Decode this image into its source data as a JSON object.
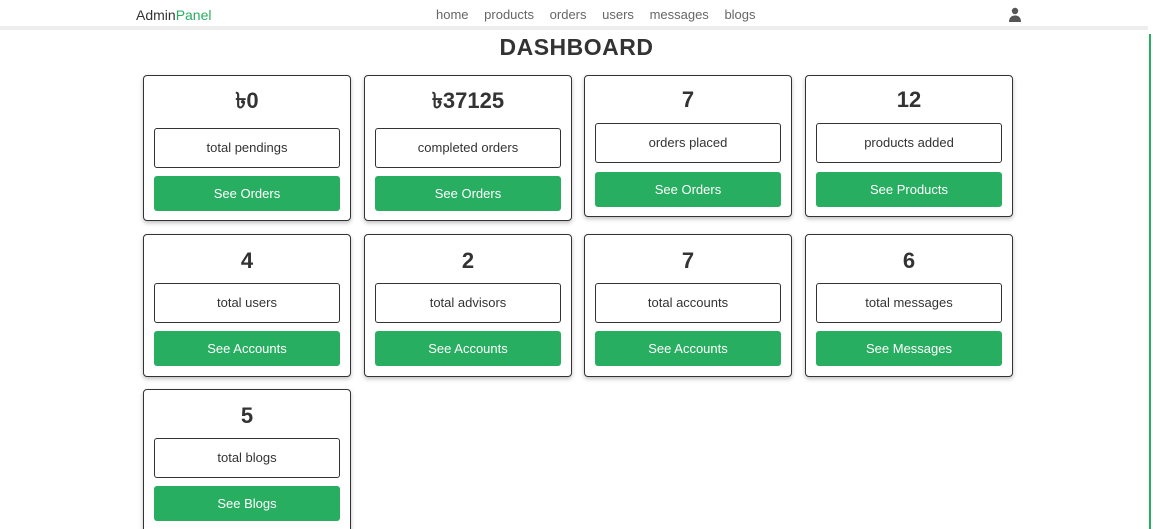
{
  "header": {
    "logo_prefix": "Admin",
    "logo_accent": "Panel",
    "nav": [
      "home",
      "products",
      "orders",
      "users",
      "messages",
      "blogs"
    ],
    "user_icon": "user-icon"
  },
  "title": "DASHBOARD",
  "colors": {
    "accent": "#27ae60",
    "text": "#333333"
  },
  "cards": [
    {
      "value": "৳0",
      "label": "total pendings",
      "button": "See Orders"
    },
    {
      "value": "৳37125",
      "label": "completed orders",
      "button": "See Orders"
    },
    {
      "value": "7",
      "label": "orders placed",
      "button": "See Orders"
    },
    {
      "value": "12",
      "label": "products added",
      "button": "See Products"
    },
    {
      "value": "4",
      "label": "total users",
      "button": "See Accounts"
    },
    {
      "value": "2",
      "label": "total advisors",
      "button": "See Accounts"
    },
    {
      "value": "7",
      "label": "total accounts",
      "button": "See Accounts"
    },
    {
      "value": "6",
      "label": "total messages",
      "button": "See Messages"
    },
    {
      "value": "5",
      "label": "total blogs",
      "button": "See Blogs"
    }
  ]
}
